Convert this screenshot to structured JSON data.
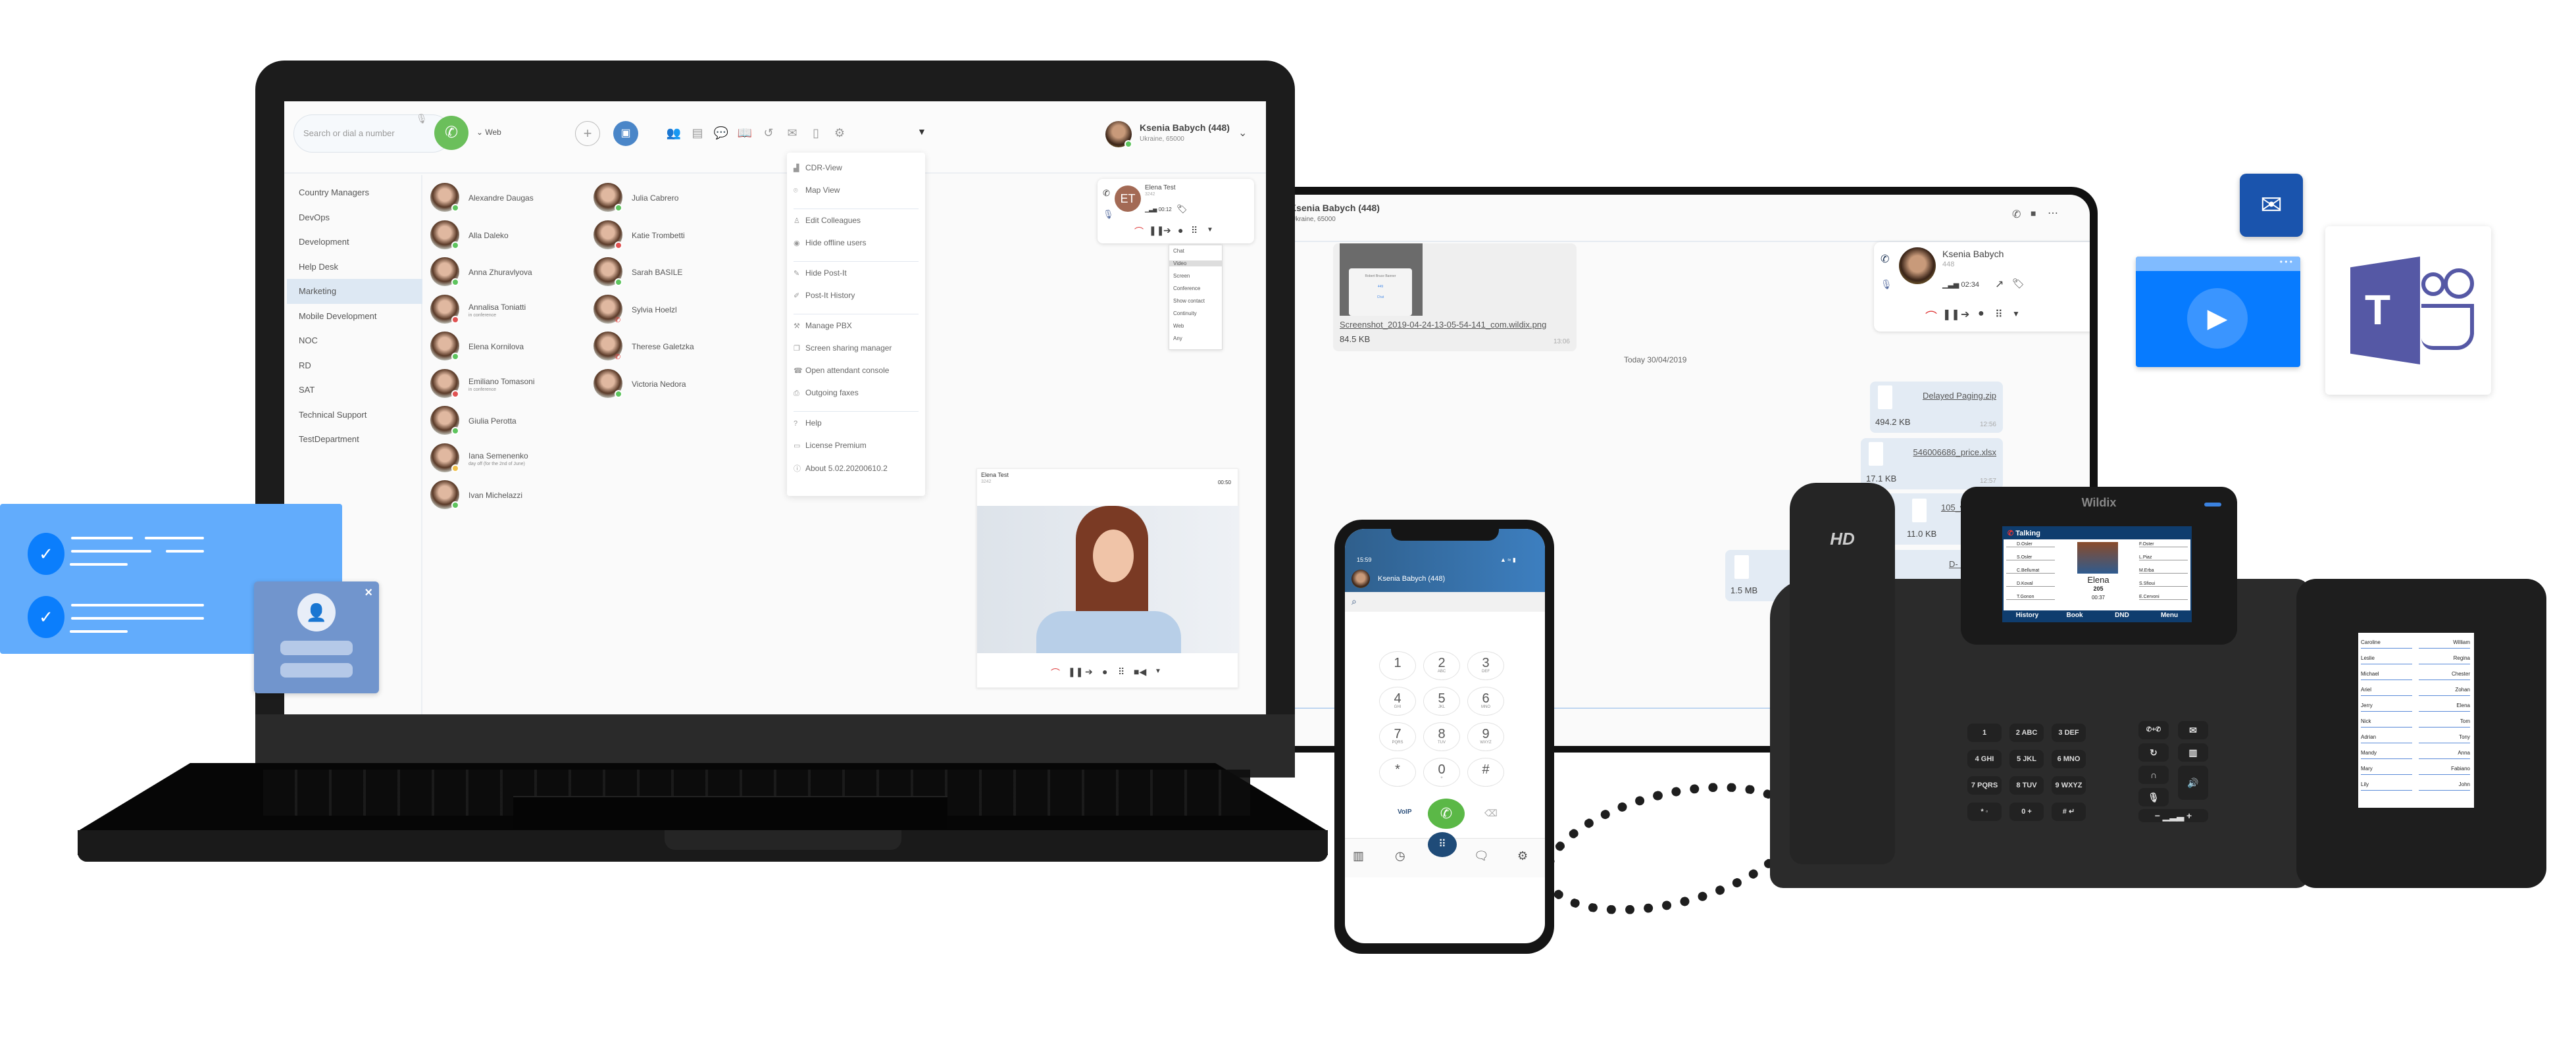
{
  "laptop": {
    "search": {
      "placeholder": "Search or dial a number"
    },
    "device_selector": "Web",
    "toolbar_icons": [
      "colleagues-icon",
      "function-keys-icon",
      "chat-icon",
      "phonebook-icon",
      "history-icon",
      "voicemail-icon",
      "sidebar-icon",
      "settings-icon"
    ],
    "user": {
      "name": "Ksenia Babych (448)",
      "location": "Ukraine, 65000",
      "status_color": "#5ec45e"
    },
    "departments": [
      {
        "label": "Country Managers"
      },
      {
        "label": "DevOps"
      },
      {
        "label": "Development"
      },
      {
        "label": "Help Desk"
      },
      {
        "label": "Marketing",
        "active": true
      },
      {
        "label": "Mobile Development"
      },
      {
        "label": "NOC"
      },
      {
        "label": "RD"
      },
      {
        "label": "SAT"
      },
      {
        "label": "Technical Support"
      },
      {
        "label": "TestDepartment"
      }
    ],
    "contacts_col1": [
      {
        "name": "Alexandre Daugas",
        "status": "",
        "presence": "online"
      },
      {
        "name": "Alla Daleko",
        "status": "",
        "presence": "online"
      },
      {
        "name": "Anna Zhuravlyova",
        "status": "",
        "presence": "online"
      },
      {
        "name": "Annalisa Toniatti",
        "status": "in conference",
        "presence": "busy"
      },
      {
        "name": "Elena Kornilova",
        "status": "",
        "presence": "online"
      },
      {
        "name": "Emiliano Tomasoni",
        "status": "in conference",
        "presence": "busy"
      },
      {
        "name": "Giulia Perotta",
        "status": "",
        "presence": "online"
      },
      {
        "name": "Iana Semenenko",
        "status": "day off (for the 2nd of June)",
        "presence": "away"
      },
      {
        "name": "Ivan Michelazzi",
        "status": "",
        "presence": "online"
      }
    ],
    "contacts_col2": [
      {
        "name": "Julia Cabrero",
        "status": "",
        "presence": "online"
      },
      {
        "name": "Katie Trombetti",
        "status": "",
        "presence": "dnd"
      },
      {
        "name": "Sarah BASILE",
        "status": "",
        "presence": "online"
      },
      {
        "name": "Sylvia Hoelzl",
        "status": "",
        "presence": "ringing"
      },
      {
        "name": "Therese Galetzka",
        "status": "",
        "presence": "ringing"
      },
      {
        "name": "Victoria Nedora",
        "status": "",
        "presence": "online"
      }
    ],
    "presence_colors": {
      "online": "#5ec45e",
      "busy": "#e05252",
      "dnd": "#e05252",
      "away": "#f0c04a",
      "ringing": "#e53935"
    },
    "menu": [
      {
        "icon": "chart-icon",
        "glyph": "▟",
        "label": "CDR-View"
      },
      {
        "icon": "map-pin-icon",
        "glyph": "⌾",
        "label": "Map View",
        "sep_after": true
      },
      {
        "icon": "edit-user-icon",
        "glyph": "♙",
        "label": "Edit Colleagues"
      },
      {
        "icon": "eye-icon",
        "glyph": "◉",
        "label": "Hide offline users",
        "sep_after": true
      },
      {
        "icon": "pin-icon",
        "glyph": "✎",
        "label": "Hide Post-It"
      },
      {
        "icon": "pin-history-icon",
        "glyph": "✐",
        "label": "Post-It History",
        "sep_after": true
      },
      {
        "icon": "wrench-icon",
        "glyph": "⚒",
        "label": "Manage PBX"
      },
      {
        "icon": "screens-icon",
        "glyph": "❐",
        "label": "Screen sharing manager"
      },
      {
        "icon": "console-icon",
        "glyph": "☎",
        "label": "Open attendant console"
      },
      {
        "icon": "fax-icon",
        "glyph": "⎙",
        "label": "Outgoing faxes",
        "sep_after": true
      },
      {
        "icon": "help-icon",
        "glyph": "?",
        "label": "Help"
      },
      {
        "icon": "license-icon",
        "glyph": "▭",
        "label": "License Premium"
      },
      {
        "icon": "info-icon",
        "glyph": "ⓘ",
        "label": "About 5.02.20200610.2"
      }
    ],
    "active_call": {
      "initials": "ET",
      "name": "Elena Test",
      "number": "3242",
      "duration": "00:12"
    },
    "call_submenu": [
      "Chat",
      "Video",
      "Screen",
      "Conference",
      "Show contact",
      "Continuity",
      "Web",
      "Any"
    ],
    "call_submenu_highlight": "Video",
    "video_call": {
      "name": "Elena Test",
      "number": "3242",
      "duration": "00:50"
    }
  },
  "tablet": {
    "header": {
      "name": "Ksenia Babych (448)",
      "location": "Ukraine, 65000"
    },
    "call": {
      "name": "Ksenia Babych",
      "number": "448",
      "duration": "02:34"
    },
    "messages": [
      {
        "file": "Screenshot_2019-04-24-13-05-54-141_com.wildix.png",
        "size": "84.5 KB",
        "time": "13:06",
        "preview": [
          "Robert Bruce Banner",
          "449",
          "Chat",
          "Cancel"
        ]
      },
      {
        "file": "Delayed Paging.zip",
        "size": "494.2 KB",
        "time": "12:56"
      },
      {
        "file": "546006686_price.xlsx",
        "size": "17.1 KB",
        "time": "12:57"
      },
      {
        "file": "105_ww",
        "size": "11.0 KB",
        "time": ""
      },
      {
        "file": "D- May 2019",
        "size": "1.5 MB",
        "time": ""
      }
    ],
    "date_separator": "Today 30/04/2019"
  },
  "mobile": {
    "status_time": "15:59",
    "user": "Ksenia Babych (448)",
    "keypad": [
      {
        "d": "1",
        "l": ""
      },
      {
        "d": "2",
        "l": "ABC"
      },
      {
        "d": "3",
        "l": "DEF"
      },
      {
        "d": "4",
        "l": "GHI"
      },
      {
        "d": "5",
        "l": "JKL"
      },
      {
        "d": "6",
        "l": "MNO"
      },
      {
        "d": "7",
        "l": "PQRS"
      },
      {
        "d": "8",
        "l": "TUV"
      },
      {
        "d": "9",
        "l": "WXYZ"
      },
      {
        "d": "*",
        "l": ""
      },
      {
        "d": "0",
        "l": "+"
      },
      {
        "d": "#",
        "l": ""
      }
    ],
    "voip_label": "VoIP",
    "tabs": [
      "phonebook-icon",
      "history-icon",
      "dialpad-icon",
      "chat-icon",
      "settings-icon"
    ]
  },
  "deskphone": {
    "brand": "Wildix",
    "handset_label": "HD",
    "screen_title": "Talking",
    "left_blf": [
      "D.Osler",
      "S.Osler",
      "C.Bellumat",
      "D.Koval",
      "T.Gonon"
    ],
    "right_blf": [
      "F.Oster",
      "L.Piaz",
      "M.Erba",
      "S.Sfioui",
      "E.Cervoni"
    ],
    "caller": {
      "name": "Elena",
      "ext": "205",
      "duration": "00:37"
    },
    "softkeys": [
      "History",
      "Book",
      "DND",
      "Menu"
    ],
    "keypad": [
      "1",
      "2 ABC",
      "3 DEF",
      "4 GHI",
      "5 JKL",
      "6 MNO",
      "7 PQRS",
      "8 TUV",
      "9 WXYZ",
      "* ◦",
      "0 +",
      "# ↵"
    ],
    "sidecar_left": [
      "Caroline",
      "Leslie",
      "Michael",
      "Ariel",
      "Jerry",
      "Nick",
      "Adrian",
      "Mandy",
      "Mary",
      "Lily"
    ],
    "sidecar_right": [
      "William",
      "Regina",
      "Chester",
      "Zohan",
      "Elena",
      "Tom",
      "Tony",
      "Anna",
      "Fabiano",
      "John"
    ]
  },
  "decor": {
    "teams_letter": "T",
    "colors": {
      "card": "#62acfc",
      "check": "#0b7efc",
      "mail": "#1a54ad",
      "video": "#077bff",
      "teams": "#5558a5"
    }
  }
}
